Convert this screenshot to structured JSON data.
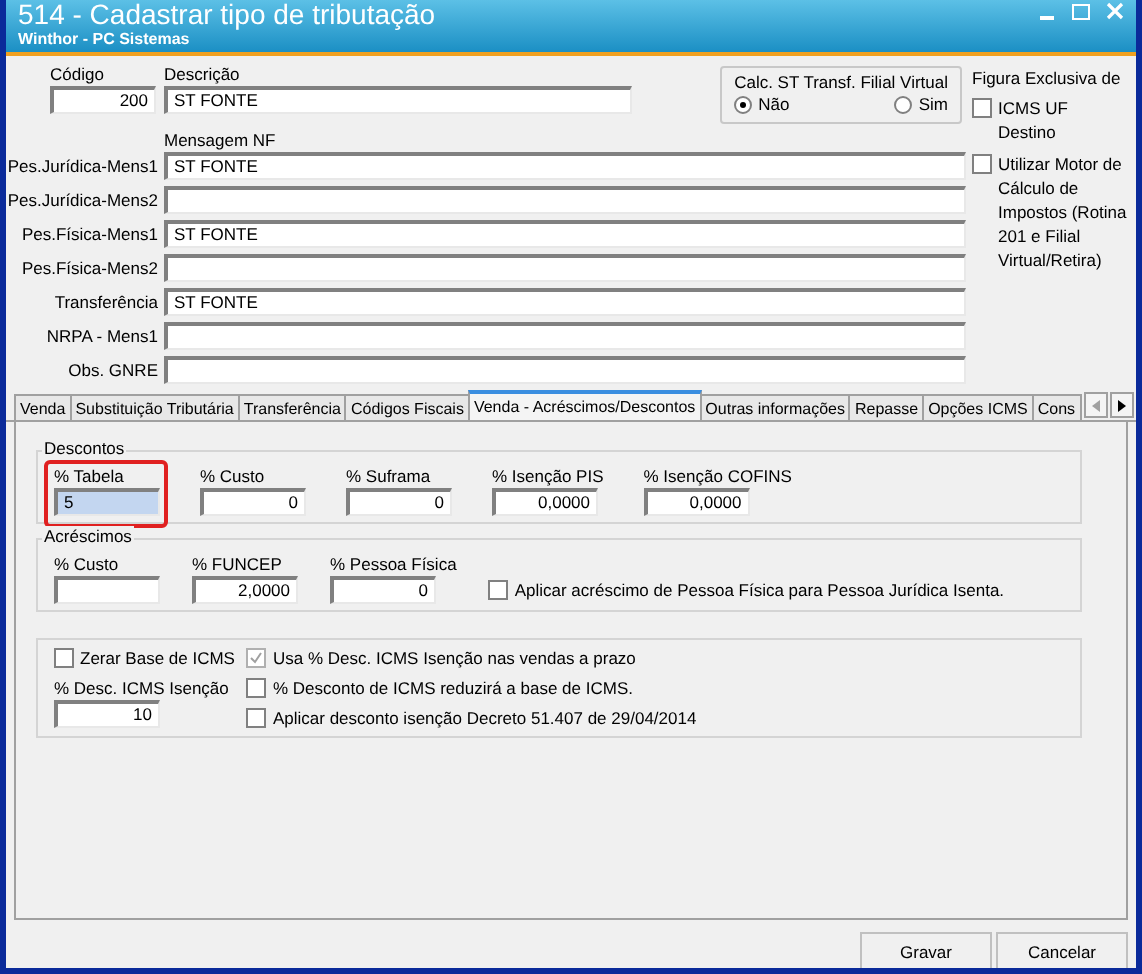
{
  "window": {
    "title": "514 - Cadastrar tipo de tributação",
    "subtitle": "Winthor - PC Sistemas"
  },
  "header": {
    "codigo": {
      "label": "Código",
      "value": "200"
    },
    "descricao": {
      "label": "Descrição",
      "value": "ST FONTE"
    },
    "calc_st": {
      "title": "Calc. ST Transf. Filial Virtual",
      "options": [
        {
          "label": "Não",
          "selected": true
        },
        {
          "label": "Sim",
          "selected": false
        }
      ]
    },
    "mensagem_label": "Mensagem NF",
    "messages": [
      {
        "label": "Pes.Jurídica-Mens1",
        "value": "ST FONTE"
      },
      {
        "label": "Pes.Jurídica-Mens2"
      },
      {
        "label": "Pes.Física-Mens1",
        "value": "ST FONTE"
      },
      {
        "label": "Pes.Física-Mens2"
      },
      {
        "label": "Transferência",
        "value": "ST FONTE"
      },
      {
        "label": "NRPA - Mens1"
      },
      {
        "label": "Obs. GNRE"
      }
    ],
    "figura_title": "Figura Exclusiva de",
    "side_checks": [
      {
        "label": "ICMS UF Destino",
        "checked": false
      },
      {
        "label": "Utilizar Motor de Cálculo de Impostos (Rotina 201 e Filial Virtual/Retira)",
        "checked": false
      }
    ]
  },
  "tabs": [
    {
      "label": "Venda",
      "selected": false
    },
    {
      "label": "Substituição Tributária",
      "selected": false
    },
    {
      "label": "Transferência",
      "selected": false
    },
    {
      "label": "Códigos Fiscais",
      "selected": false
    },
    {
      "label": "Venda - Acréscimos/Descontos",
      "selected": true
    },
    {
      "label": "Outras informações",
      "selected": false
    },
    {
      "label": "Repasse",
      "selected": false
    },
    {
      "label": "Opções ICMS",
      "selected": false
    },
    {
      "label": "Cons",
      "selected": false
    }
  ],
  "descontos": {
    "title": "Descontos",
    "fields": [
      {
        "label": "% Tabela",
        "value": "5",
        "highlighted": true
      },
      {
        "label": "% Custo",
        "value": "0",
        "highlighted": false
      },
      {
        "label": "% Suframa",
        "value": "0",
        "highlighted": false
      },
      {
        "label": "% Isenção PIS",
        "value": "0,0000",
        "highlighted": false
      },
      {
        "label": "% Isenção COFINS",
        "value": "0,0000",
        "highlighted": false
      }
    ]
  },
  "acrescimos": {
    "title": "Acréscimos",
    "fields": [
      {
        "label": "% Custo"
      },
      {
        "label": "% FUNCEP",
        "value": "2,0000"
      },
      {
        "label": "% Pessoa Física",
        "value": "0"
      }
    ],
    "check": {
      "label": "Aplicar acréscimo de Pessoa Física para Pessoa Jurídica Isenta.",
      "checked": false
    }
  },
  "icms": {
    "zerar": {
      "label": "Zerar Base de ICMS",
      "checked": false
    },
    "desc_field": {
      "label": "% Desc. ICMS Isenção",
      "value": "10"
    },
    "checks": [
      {
        "label": "Usa % Desc. ICMS Isenção nas vendas a prazo",
        "checked": true,
        "disabled": true
      },
      {
        "label": "% Desconto de ICMS reduzirá a base de ICMS.",
        "checked": false,
        "disabled": false
      },
      {
        "label": "Aplicar desconto isenção Decreto 51.407 de 29/04/2014",
        "checked": false,
        "disabled": false
      }
    ]
  },
  "buttons": [
    "Gravar",
    "Cancelar"
  ]
}
